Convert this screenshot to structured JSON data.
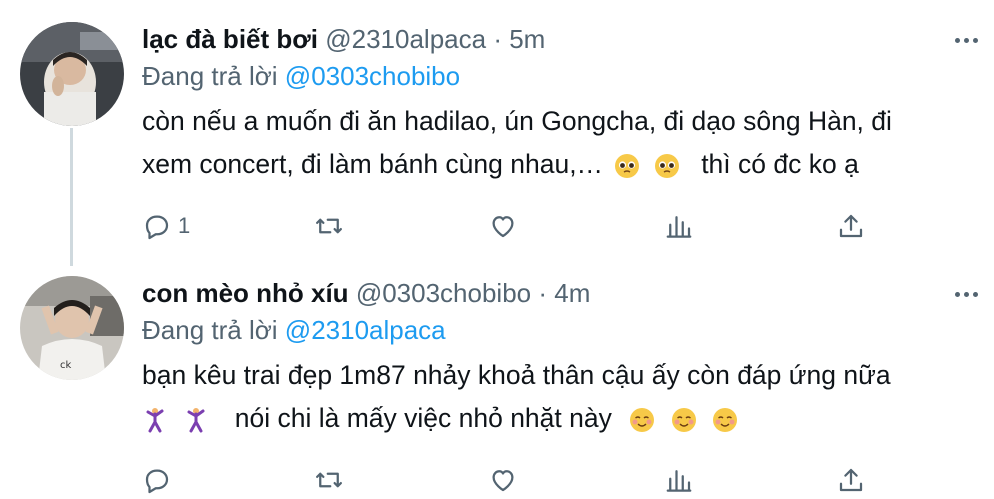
{
  "colors": {
    "text": "#0f1419",
    "secondary": "#536471",
    "link": "#1d9bf0",
    "thread_line": "#cfd9de"
  },
  "tweets": [
    {
      "display_name": "lạc đà biết bơi",
      "handle": "@2310alpaca",
      "separator": "·",
      "time": "5m",
      "reply_prefix": "Đang trả lời",
      "reply_to": "@0303chobibo",
      "body_line1": "còn nếu a muốn đi ăn hadilao, ún Gongcha, đi dạo sông Hàn, đi",
      "body_line2_text": "xem concert, đi làm bánh cùng nhau,…",
      "body_line2_emojis": [
        "pleading-face",
        "pleading-face"
      ],
      "body_line2_tail": "thì có đc ko ạ",
      "reply_count": "1"
    },
    {
      "display_name": "con mèo nhỏ xíu",
      "handle": "@0303chobibo",
      "separator": "·",
      "time": "4m",
      "reply_prefix": "Đang trả lời",
      "reply_to": "@2310alpaca",
      "body_line1": "bạn kêu trai đẹp 1m87 nhảy khoả thân cậu ấy còn đáp ứng nữa",
      "body_line2_emojis_lead": [
        "dancing-man",
        "dancing-man"
      ],
      "body_line2_text": "nói chi là mấy việc nhỏ nhặt này",
      "body_line2_emojis_tail": [
        "smiling-face",
        "smiling-face",
        "smiling-face"
      ],
      "reply_count": ""
    }
  ],
  "icons": {
    "reply": "reply-bubble-icon",
    "retweet": "retweet-icon",
    "like": "heart-icon",
    "analytics": "analytics-icon",
    "share": "share-icon",
    "more": "more-dots-icon"
  }
}
